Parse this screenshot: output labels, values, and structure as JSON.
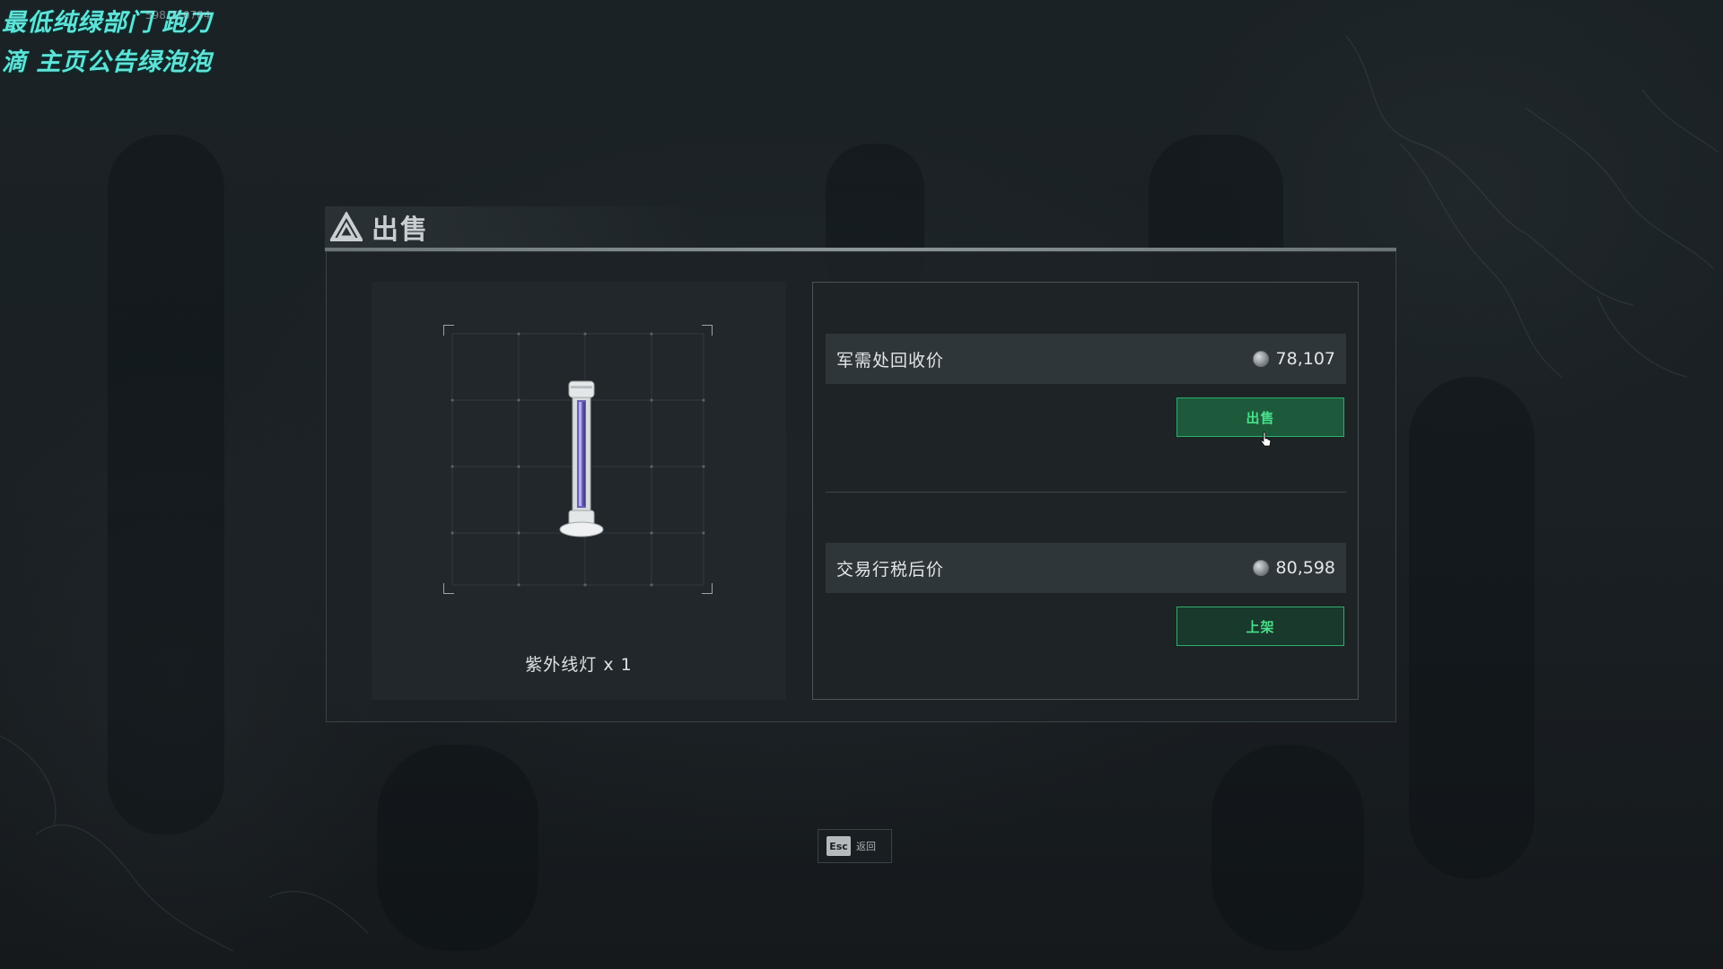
{
  "overlay": {
    "line1": "最低纯绿部门  跑刀",
    "line2": "滴  主页公告绿泡泡",
    "id_text": "598 210704"
  },
  "panel": {
    "title": "出售",
    "title_icon": "delta-triangle-icon"
  },
  "item": {
    "name": "紫外线灯 x 1",
    "icon": "uv-lamp-icon"
  },
  "prices": {
    "recycle": {
      "label": "军需处回收价",
      "value": "78,107",
      "currency_icon": "coin-icon"
    },
    "market": {
      "label": "交易行税后价",
      "value": "80,598",
      "currency_icon": "coin-icon"
    }
  },
  "buttons": {
    "sell_label": "出售",
    "list_label": "上架"
  },
  "esc": {
    "key": "Esc",
    "label": "返回"
  },
  "colors": {
    "accent_green": "#49e08a",
    "button_border": "#2cae6b",
    "overlay_text": "#5fe3d9"
  }
}
